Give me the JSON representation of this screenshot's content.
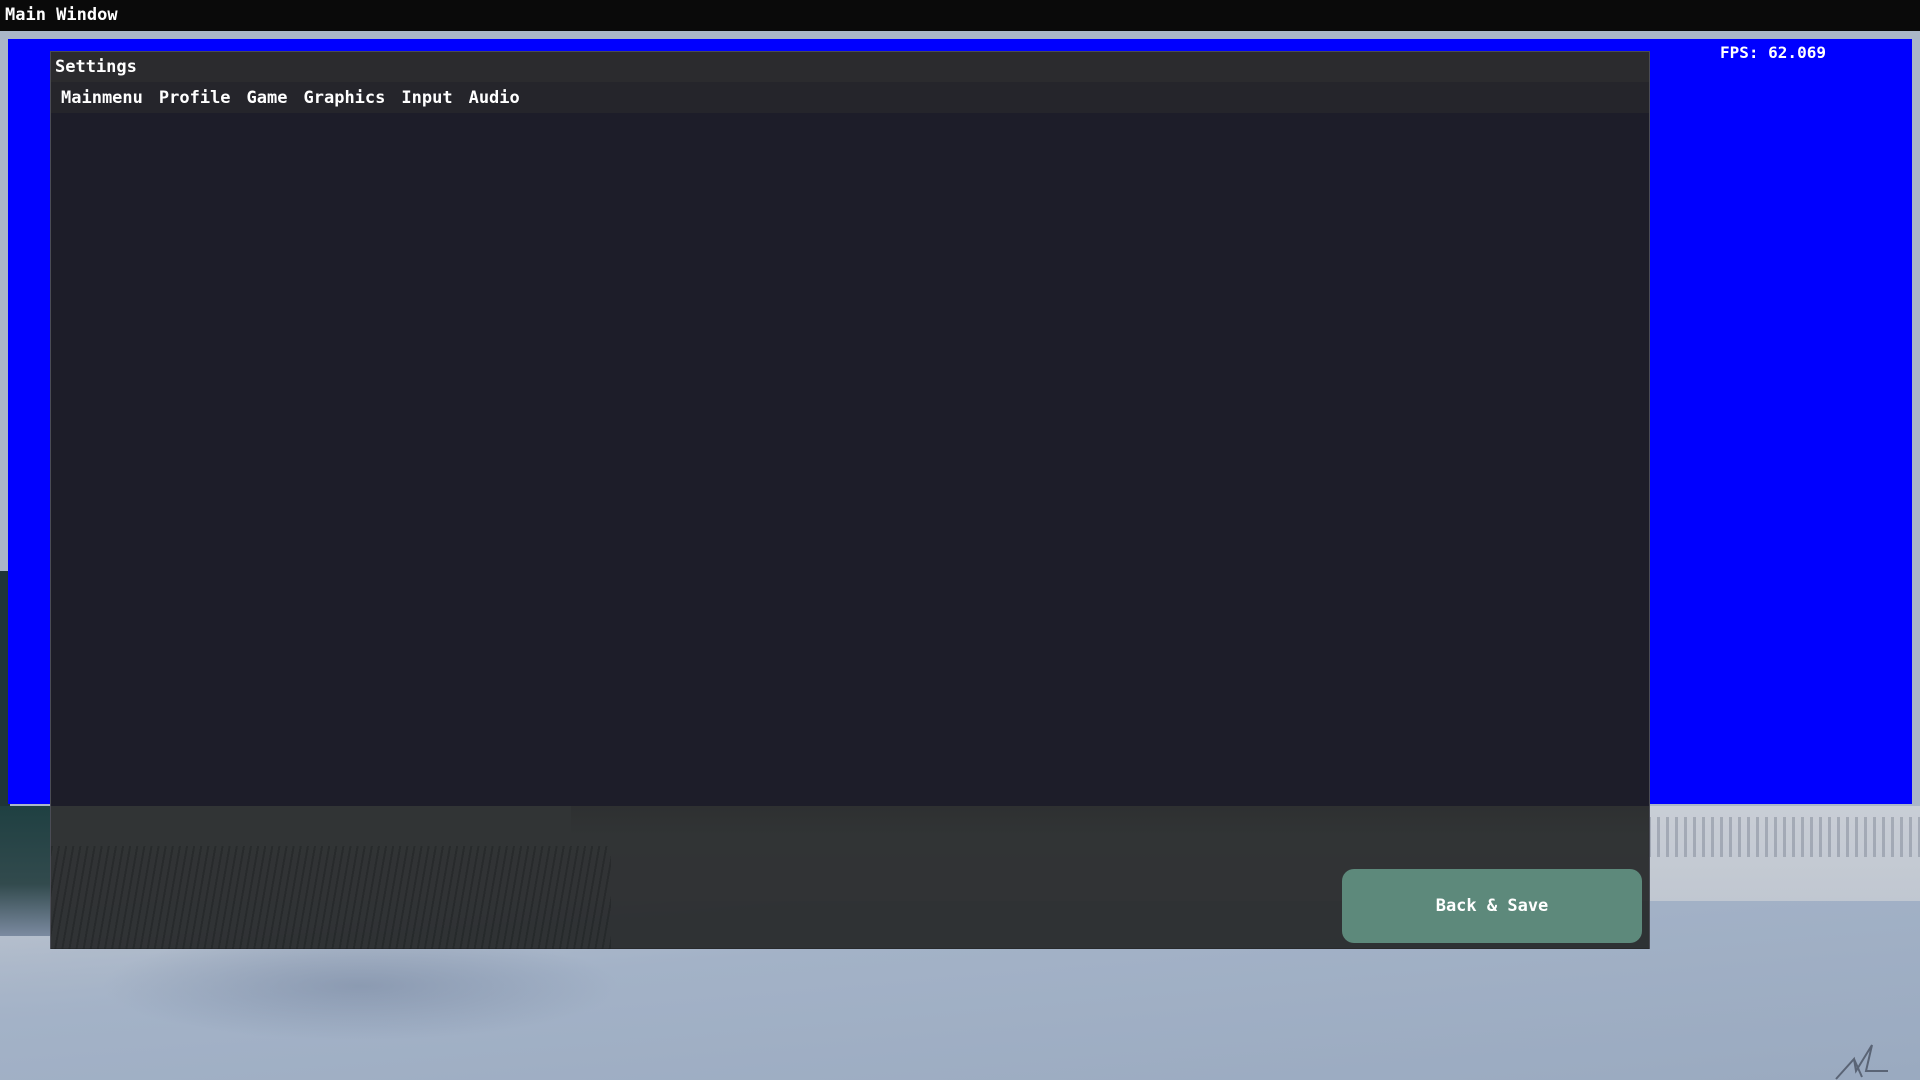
{
  "window": {
    "title": "Main Window"
  },
  "hud": {
    "fps_text": "FPS: 62.069"
  },
  "settings": {
    "title": "Settings",
    "tabs": [
      {
        "label": "Mainmenu"
      },
      {
        "label": "Profile"
      },
      {
        "label": "Game"
      },
      {
        "label": "Graphics"
      },
      {
        "label": "Input"
      },
      {
        "label": "Audio"
      }
    ],
    "back_save_label": "Back & Save"
  },
  "colors": {
    "sky": "#0000ff",
    "title_bar": "#0a0a0a",
    "settings_body": "#1d1d29",
    "back_save_button": "#5d897b"
  },
  "icons": {
    "corner_glyph": "bird-icon"
  }
}
